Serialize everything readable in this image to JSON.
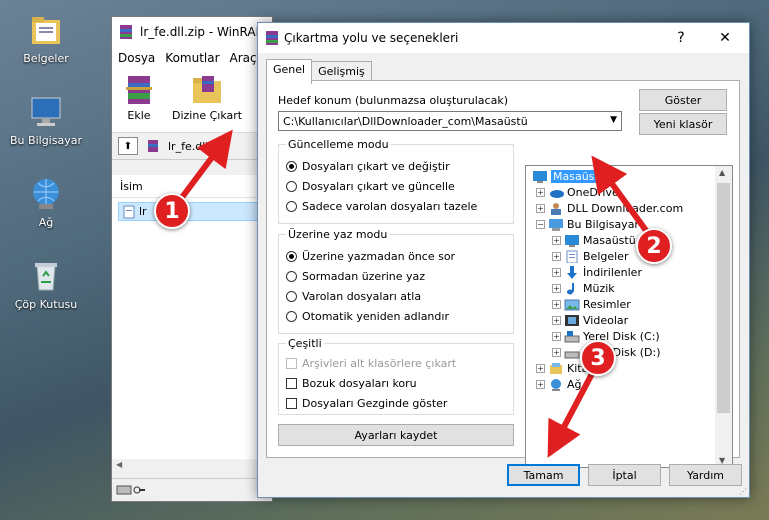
{
  "desktop": {
    "icons": [
      {
        "label": "Belgeler",
        "icon": "folder-documents-icon"
      },
      {
        "label": "Bu Bilgisayar",
        "icon": "computer-icon"
      },
      {
        "label": "Ağ",
        "icon": "network-icon"
      },
      {
        "label": "Çöp Kutusu",
        "icon": "recycle-bin-icon"
      }
    ]
  },
  "winrar": {
    "title": "lr_fe.dll.zip - WinRAR",
    "menu": [
      "Dosya",
      "Komutlar",
      "Araçla"
    ],
    "toolbar": {
      "add_label": "Ekle",
      "extract_label": "Dizine Çıkart"
    },
    "address": "lr_fe.dll.zip",
    "list_header": "İsim",
    "list_item": "lr"
  },
  "dialog": {
    "title": "Çıkartma yolu ve seçenekleri",
    "help_btn": "?",
    "close_btn": "✕",
    "tabs": [
      "Genel",
      "Gelişmiş"
    ],
    "dest_label": "Hedef konum (bulunmazsa oluşturulacak)",
    "dest_value": "C:\\Kullanıcılar\\DllDownloader_com\\Masaüstü",
    "show_btn": "Göster",
    "new_folder_btn": "Yeni klasör",
    "update_mode": {
      "title": "Güncelleme modu",
      "options": [
        "Dosyaları çıkart ve değiştir",
        "Dosyaları çıkart ve güncelle",
        "Sadece varolan dosyaları tazele"
      ],
      "selected": 0
    },
    "overwrite_mode": {
      "title": "Üzerine yaz modu",
      "options": [
        "Üzerine yazmadan önce sor",
        "Sormadan üzerine yaz",
        "Varolan dosyaları atla",
        "Otomatik yeniden adlandır"
      ],
      "selected": 0
    },
    "misc": {
      "title": "Çeşitli",
      "options": [
        "Arşivleri alt klasörlere çıkart",
        "Bozuk dosyaları koru",
        "Dosyaları Gezginde göster"
      ]
    },
    "save_settings_btn": "Ayarları kaydet",
    "tree": [
      {
        "label": "Masaüstü",
        "icon": "desktop-icon"
      },
      {
        "label": "OneDrive",
        "icon": "onedrive-icon"
      },
      {
        "label": "DLL Downloader.com",
        "icon": "user-icon"
      },
      {
        "label": "Bu Bilgisayar",
        "icon": "computer-icon"
      },
      {
        "label": "Masaüstü",
        "icon": "desktop-icon"
      },
      {
        "label": "Belgeler",
        "icon": "documents-icon"
      },
      {
        "label": "İndirilenler",
        "icon": "downloads-icon"
      },
      {
        "label": "Müzik",
        "icon": "music-icon"
      },
      {
        "label": "Resimler",
        "icon": "pictures-icon"
      },
      {
        "label": "Videolar",
        "icon": "videos-icon"
      },
      {
        "label": "Yerel Disk (C:)",
        "icon": "drive-c-icon"
      },
      {
        "label": "Yerel Disk (D:)",
        "icon": "drive-d-icon"
      },
      {
        "label": "Kitap",
        "icon": "libraries-icon"
      },
      {
        "label": "Ağ",
        "icon": "network-icon"
      }
    ],
    "ok_btn": "Tamam",
    "cancel_btn": "İptal",
    "help_bottom_btn": "Yardım"
  },
  "annotations": [
    "1",
    "2",
    "3"
  ],
  "colors": {
    "annotation": "#e02020",
    "selection": "#3399ff",
    "accent": "#0078d7"
  }
}
